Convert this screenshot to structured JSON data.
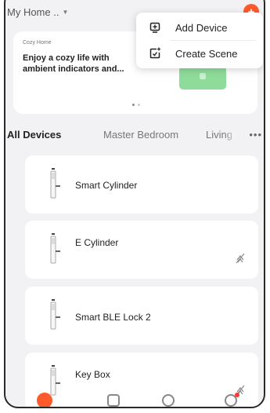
{
  "header": {
    "home_name": "My Home ..",
    "caret_icon": "caret-down-icon",
    "add_icon": "plus-icon",
    "add_symbol": "+"
  },
  "banner": {
    "tag": "Cozy Home",
    "headline": "Enjoy a cozy life with ambient indicators and...",
    "illustration_color": "#8fdc9a",
    "page_indicator": {
      "count": 2,
      "active": 1
    }
  },
  "popover": {
    "items": [
      {
        "label": "Add Device",
        "icon": "add-device-icon"
      },
      {
        "label": "Create Scene",
        "icon": "create-scene-icon"
      }
    ]
  },
  "tabs": {
    "items": [
      "All Devices",
      "Master Bedroom",
      "Living"
    ],
    "active": 0,
    "more": "•••"
  },
  "devices": [
    {
      "name": "Smart Cylinder",
      "icon": "door-lock-icon",
      "offline": false
    },
    {
      "name": "E Cylinder",
      "icon": "door-lock-icon",
      "offline": true
    },
    {
      "name": "Smart BLE Lock 2",
      "icon": "door-lock-icon",
      "offline": false
    },
    {
      "name": "Key Box",
      "icon": "door-lock-icon",
      "offline": true
    }
  ],
  "bottom_nav": {
    "items": [
      {
        "icon": "home-icon",
        "active": true
      },
      {
        "icon": "scene-icon",
        "active": false
      },
      {
        "icon": "smart-icon",
        "active": false
      },
      {
        "icon": "me-icon",
        "active": false,
        "badge": true
      }
    ]
  },
  "colors": {
    "accent": "#ff5a2a",
    "background": "#f2f2f4",
    "card": "#ffffff",
    "text_primary": "#222222",
    "text_secondary": "#777777"
  }
}
